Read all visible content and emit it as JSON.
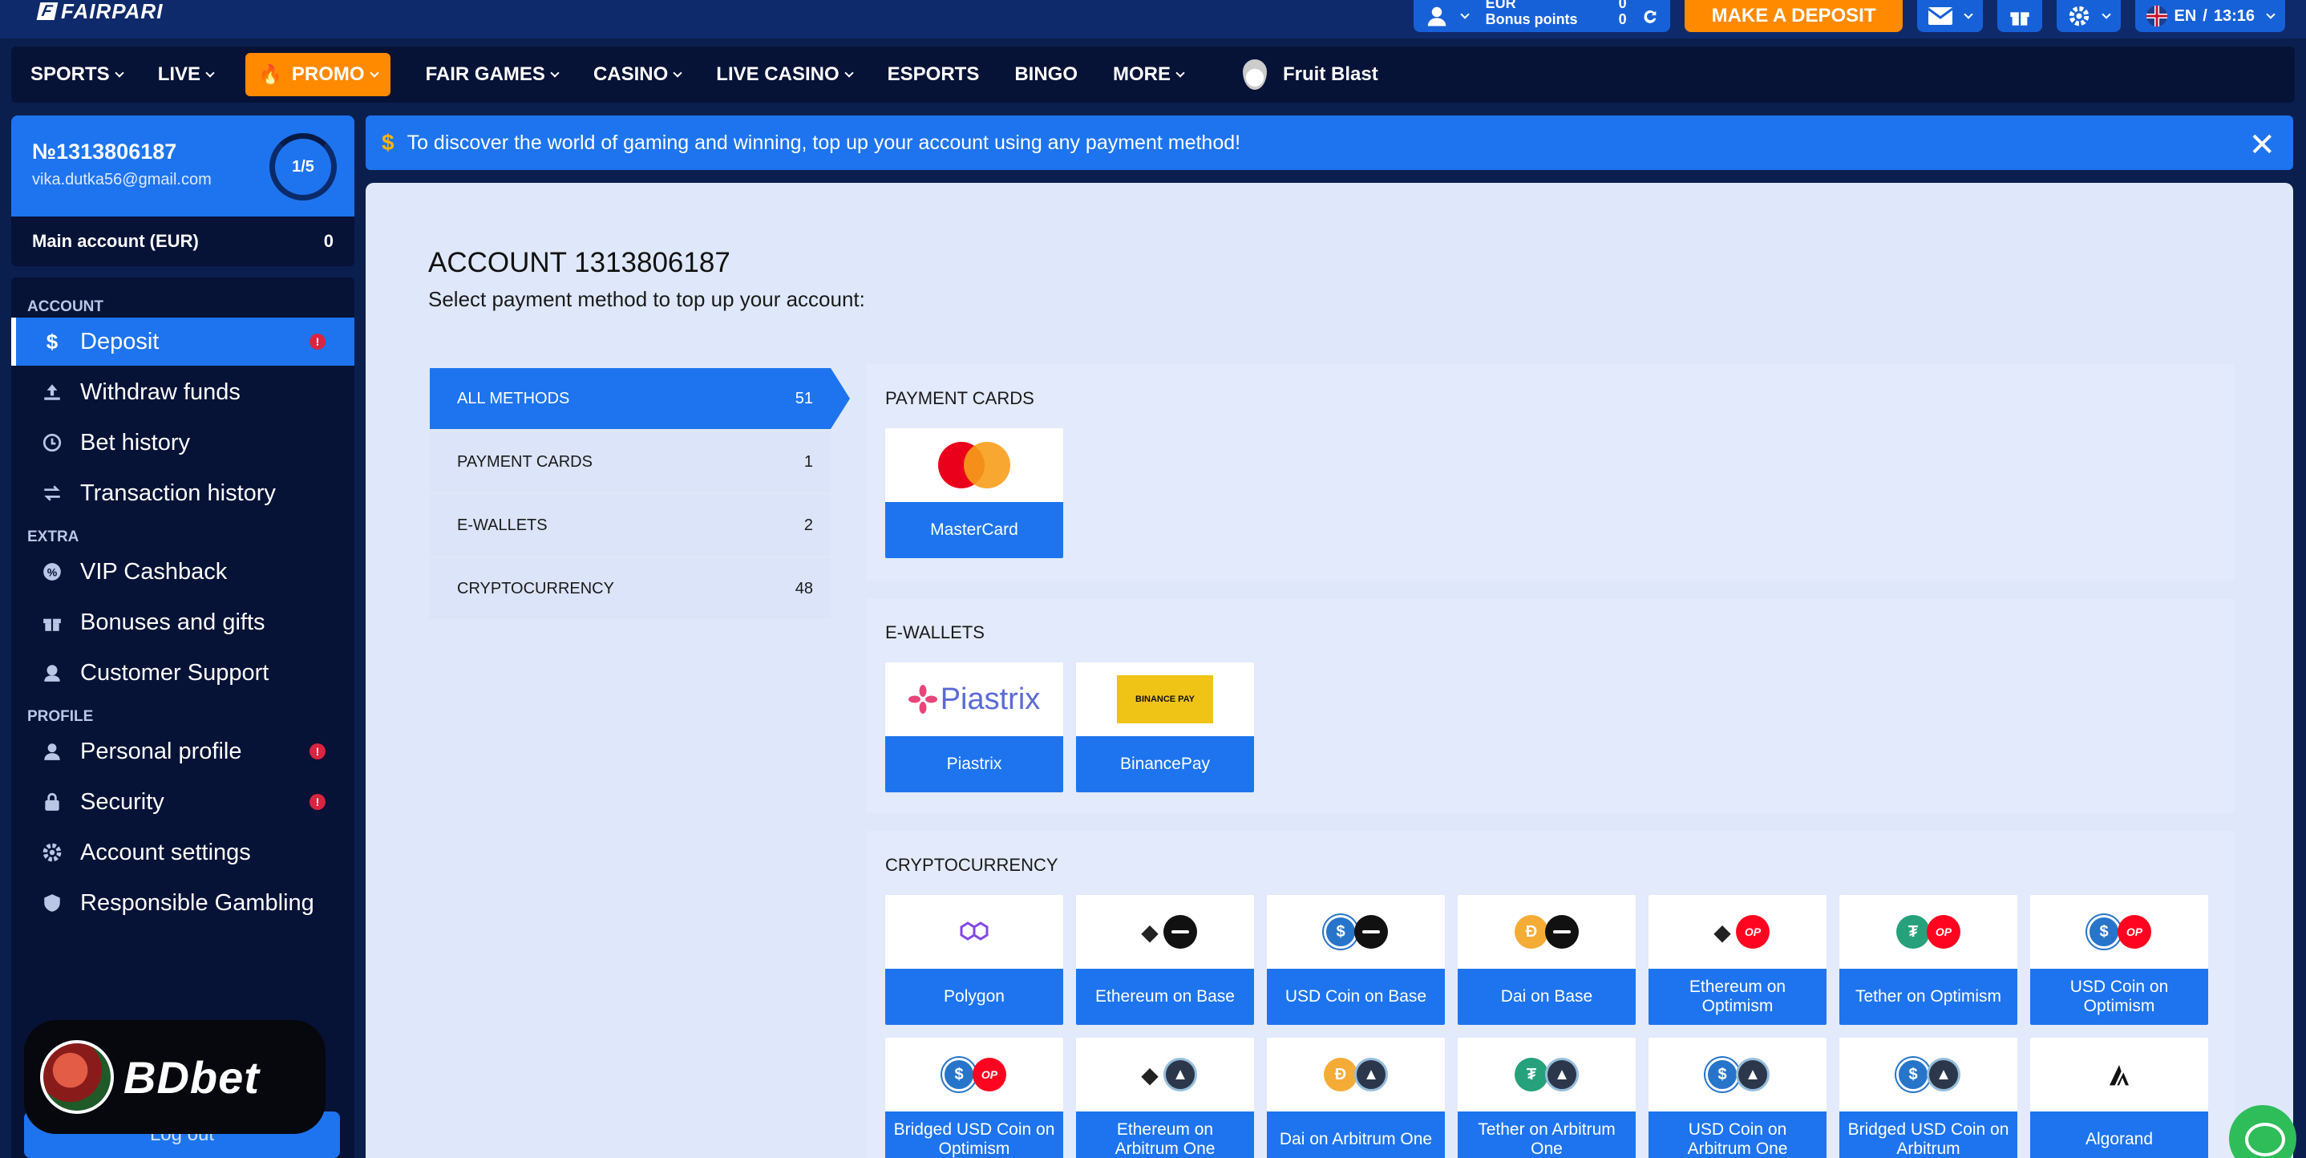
{
  "header": {
    "logo_text": "FAIRPARI",
    "account": {
      "currency": "EUR",
      "balance": "0",
      "bonus_label": "Bonus points",
      "bonus_value": "0"
    },
    "deposit_button": "MAKE A DEPOSIT",
    "language": "EN",
    "time": "13:16"
  },
  "nav": {
    "items": [
      {
        "label": "SPORTS"
      },
      {
        "label": "LIVE"
      },
      {
        "label": "PROMO"
      },
      {
        "label": "FAIR GAMES"
      },
      {
        "label": "CASINO"
      },
      {
        "label": "LIVE CASINO"
      },
      {
        "label": "ESPORTS"
      },
      {
        "label": "BINGO"
      },
      {
        "label": "MORE"
      },
      {
        "label": "Fruit Blast"
      }
    ]
  },
  "profile": {
    "account_number": "№1313806187",
    "email": "vika.dutka56@gmail.com",
    "progress": "1/5",
    "main_account_label": "Main account (EUR)",
    "main_account_value": "0"
  },
  "sidebar": {
    "sections": {
      "account": "ACCOUNT",
      "extra": "EXTRA",
      "profile": "PROFILE"
    },
    "items": [
      {
        "label": "Deposit",
        "icon": "dollar-icon"
      },
      {
        "label": "Withdraw funds",
        "icon": "upload-icon"
      },
      {
        "label": "Bet history",
        "icon": "clock-icon"
      },
      {
        "label": "Transaction history",
        "icon": "swap-icon"
      },
      {
        "label": "VIP Cashback",
        "icon": "cashback-icon"
      },
      {
        "label": "Bonuses and gifts",
        "icon": "gift-icon"
      },
      {
        "label": "Customer Support",
        "icon": "support-icon"
      },
      {
        "label": "Personal profile",
        "icon": "user-icon"
      },
      {
        "label": "Security",
        "icon": "lock-icon"
      },
      {
        "label": "Account settings",
        "icon": "gear-icon"
      },
      {
        "label": "Responsible Gambling",
        "icon": "shield-icon"
      }
    ],
    "logout_label": "Log out",
    "watermark": "BDbet"
  },
  "banner": {
    "text": "To discover the world of gaming and winning, top up your account using any payment method!"
  },
  "main": {
    "title": "ACCOUNT 1313806187",
    "subtitle": "Select payment method to top up your account:",
    "categories": [
      {
        "label": "ALL METHODS",
        "count": "51"
      },
      {
        "label": "PAYMENT CARDS",
        "count": "1"
      },
      {
        "label": "E-WALLETS",
        "count": "2"
      },
      {
        "label": "CRYPTOCURRENCY",
        "count": "48"
      }
    ],
    "groups": {
      "cards": {
        "title": "PAYMENT CARDS",
        "methods": [
          "MasterCard"
        ]
      },
      "ewallets": {
        "title": "E-WALLETS",
        "methods": [
          "Piastrix",
          "BinancePay"
        ],
        "logo_text": [
          "Piastrix",
          "BINANCE PAY"
        ]
      },
      "crypto": {
        "title": "CRYPTOCURRENCY",
        "methods": [
          "Polygon",
          "Ethereum on Base",
          "USD Coin on Base",
          "Dai on Base",
          "Ethereum on Optimism",
          "Tether on Optimism",
          "USD Coin on Optimism",
          "Bridged USD Coin on Optimism",
          "Ethereum on Arbitrum One",
          "Dai on Arbitrum One",
          "Tether on Arbitrum One",
          "USD Coin on Arbitrum One",
          "Bridged USD Coin on Arbitrum",
          "Algorand"
        ]
      }
    }
  },
  "colors": {
    "brand_blue": "#1e74ee",
    "accent_orange": "#ff8a00",
    "dark_navy": "#061236",
    "alert_red": "#d9253f"
  }
}
